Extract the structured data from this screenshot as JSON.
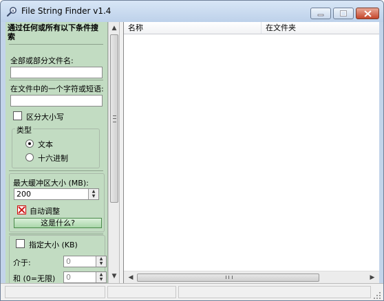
{
  "window": {
    "title": "File String Finder v1.4"
  },
  "left": {
    "search_heading": "通过任何或所有以下条件搜索",
    "filename_label": "全部或部分文件名:",
    "filename_value": "",
    "content_label": "在文件中的一个字符或短语:",
    "content_value": "",
    "case_label": "区分大小写",
    "case_checked": false,
    "type_group": "类型",
    "type_text": "文本",
    "type_hex": "十六进制",
    "type_selected": "文本",
    "buffer_label": "最大缓冲区大小 (MB):",
    "buffer_value": "200",
    "auto_label": "自动调整",
    "auto_checked": true,
    "whats_this": "这是什么?",
    "size_label": "指定大小 (KB)",
    "size_checked": false,
    "between_label": "介于:",
    "between_value": "0",
    "and_label": "和 (0=无限)",
    "and_value": "0"
  },
  "list": {
    "columns": [
      "名称",
      "在文件夹"
    ]
  },
  "colors": {
    "panel": "#c2dcc2",
    "title_bar": "#c3d4ea"
  }
}
